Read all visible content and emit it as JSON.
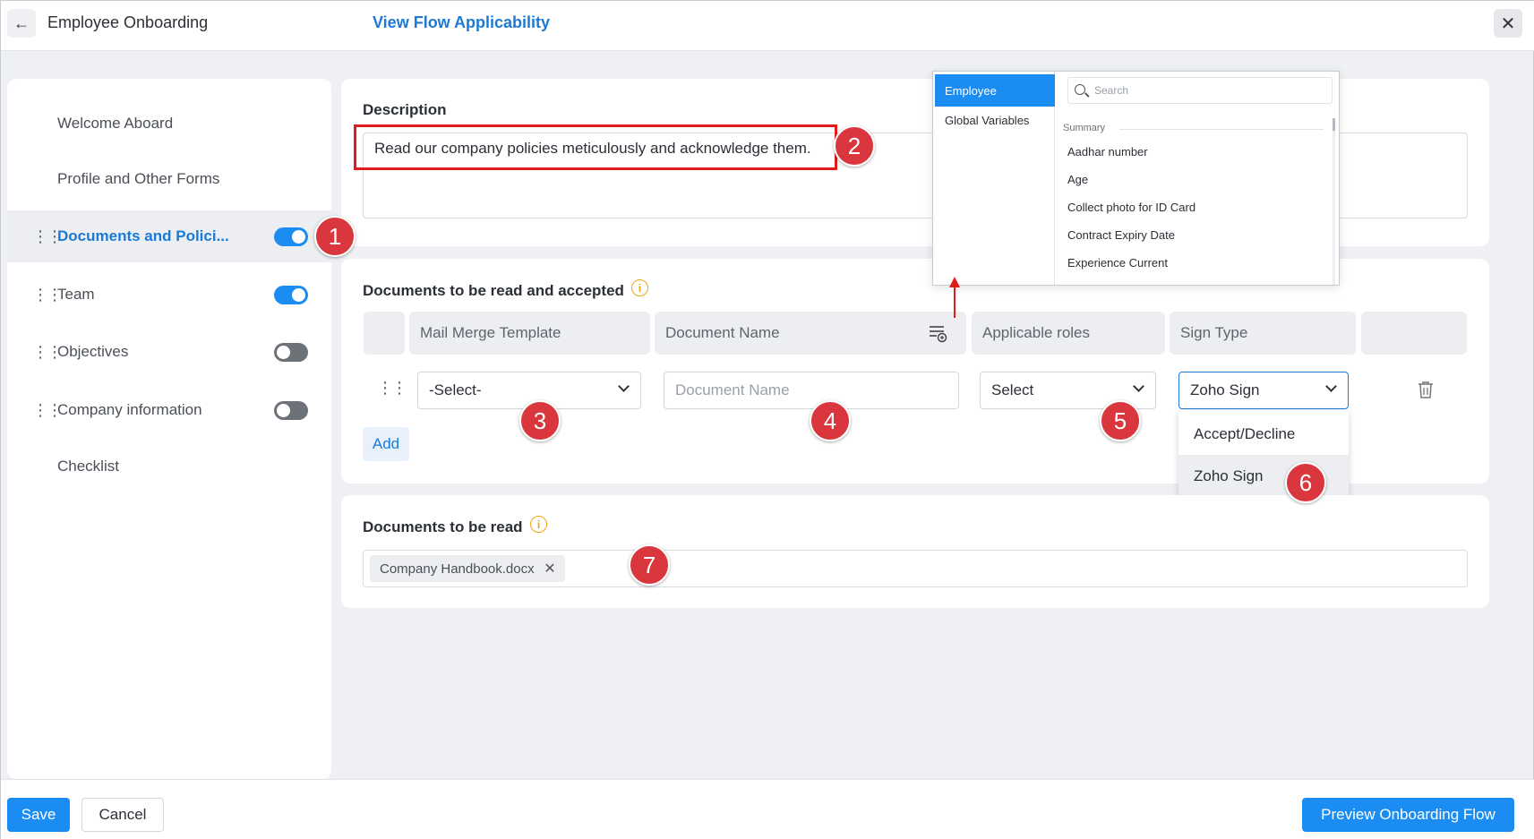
{
  "header": {
    "title": "Employee Onboarding",
    "flow_link": "View Flow Applicability"
  },
  "sidebar": {
    "items": [
      {
        "label": "Welcome Aboard"
      },
      {
        "label": "Profile and Other Forms"
      },
      {
        "label": "Documents and Polici...",
        "toggle": "on"
      },
      {
        "label": "Team",
        "toggle": "on"
      },
      {
        "label": "Objectives",
        "toggle": "off"
      },
      {
        "label": "Company information",
        "toggle": "off"
      },
      {
        "label": "Checklist"
      }
    ]
  },
  "description": {
    "title": "Description",
    "value": "Read our company policies meticulously and acknowledge them."
  },
  "docs_accept": {
    "title": "Documents to be read and accepted",
    "columns": [
      "Mail Merge Template",
      "Document Name",
      "Applicable roles",
      "Sign Type"
    ],
    "row": {
      "template_value": "-Select-",
      "document_placeholder": "Document Name",
      "roles_value": "Select",
      "sign_type_value": "Zoho Sign"
    },
    "add_label": "Add",
    "sign_type_options": [
      "Accept/Decline",
      "Zoho Sign"
    ]
  },
  "docs_read": {
    "title": "Documents to be read",
    "chip": "Company Handbook.docx"
  },
  "variables_popup": {
    "tabs": [
      "Employee",
      "Global Variables"
    ],
    "search_placeholder": "Search",
    "group": "Summary",
    "items": [
      "Aadhar number",
      "Age",
      "Collect photo for ID Card",
      "Contract Expiry Date",
      "Experience Current"
    ]
  },
  "badges": [
    "1",
    "2",
    "3",
    "4",
    "5",
    "6",
    "7"
  ],
  "footer": {
    "save": "Save",
    "cancel": "Cancel",
    "preview": "Preview Onboarding Flow"
  },
  "colors": {
    "accent": "#1a8cf2",
    "link": "#1a7ad6",
    "badge": "#d9363e",
    "highlight": "#e21b1b"
  }
}
